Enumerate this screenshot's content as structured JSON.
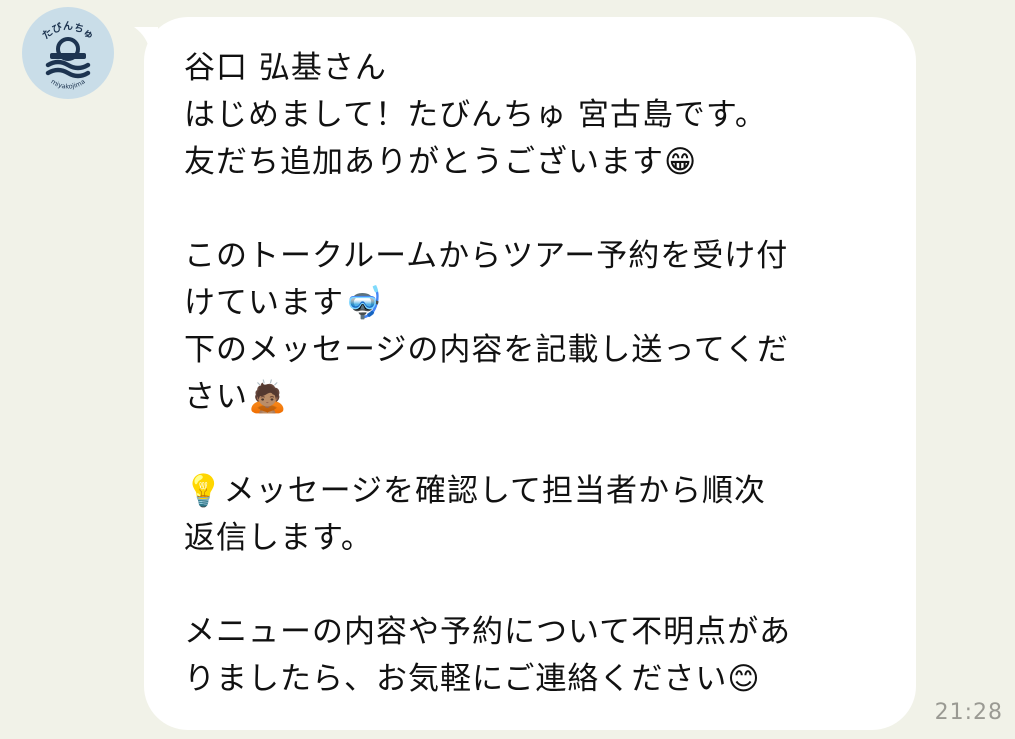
{
  "sender": {
    "avatar_text": "たびんちゅ",
    "avatar_subtext": "miyakojima"
  },
  "message": {
    "text": "谷口 弘基さん\nはじめまして！たびんちゅ 宮古島です。\n友だち追加ありがとうございます😁\n\nこのトークルームからツアー予約を受け付\nけています🤿\n下のメッセージの内容を記載し送ってくだ\nさい🙇🏽\n\n💡メッセージを確認して担当者から順次\n返信します。\n\nメニューの内容や予約について不明点があ\nりましたら、お気軽にご連絡ください😊",
    "time": "21:28"
  },
  "colors": {
    "background": "#f1f2e8",
    "bubble": "#ffffff",
    "text": "#111111",
    "timestamp": "#9a9a93",
    "avatar_bg": "#c9dde8",
    "avatar_fg": "#1d3450"
  },
  "icons": [
    "avatar-logo"
  ]
}
